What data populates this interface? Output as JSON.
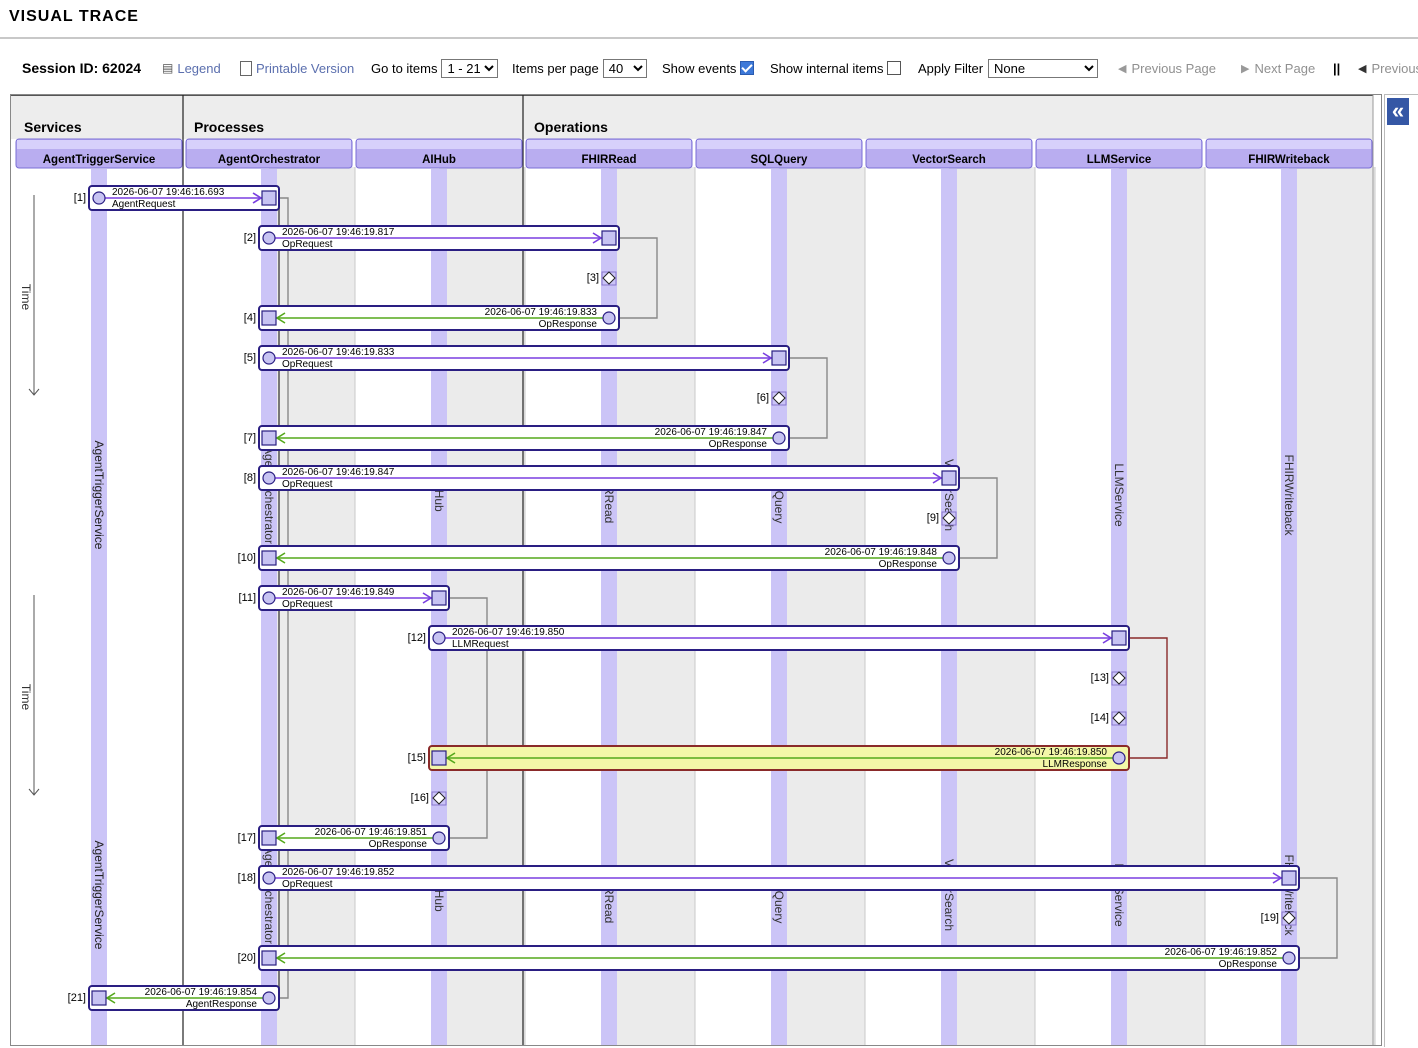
{
  "app_title": "VISUAL TRACE",
  "toolbar": {
    "session_label": "Session ID: 62024",
    "legend": "Legend",
    "printable": "Printable Version",
    "goto_label": "Go to items",
    "goto_value": "1 - 21",
    "per_page_label": "Items per page",
    "per_page_value": "40",
    "show_events_label": "Show events",
    "show_events_checked": true,
    "show_internal_label": "Show internal items",
    "show_internal_checked": false,
    "apply_filter_label": "Apply Filter",
    "filter_value": "None",
    "prev_page": "Previous Page",
    "next_page": "Next Page",
    "separator": "||",
    "previous": "Previous"
  },
  "groups": {
    "services": "Services",
    "processes": "Processes",
    "operations": "Operations"
  },
  "time_label": "Time",
  "columns": [
    {
      "name": "AgentTriggerService",
      "group": "services"
    },
    {
      "name": "AgentOrchestrator",
      "group": "processes"
    },
    {
      "name": "AIHub",
      "group": "processes"
    },
    {
      "name": "FHIRRead",
      "group": "operations"
    },
    {
      "name": "SQLQuery",
      "group": "operations"
    },
    {
      "name": "VectorSearch",
      "group": "operations"
    },
    {
      "name": "LLMService",
      "group": "operations"
    },
    {
      "name": "FHIRWriteback",
      "group": "operations"
    }
  ],
  "messages": [
    {
      "index": "[1]",
      "from": 0,
      "to": 1,
      "timestamp": "2026-06-07 19:46:16.693",
      "type": "AgentRequest",
      "kind": "request"
    },
    {
      "index": "[2]",
      "from": 1,
      "to": 3,
      "timestamp": "2026-06-07 19:46:19.817",
      "type": "OpRequest",
      "kind": "request"
    },
    {
      "index": "[3]",
      "col": 3,
      "kind": "event"
    },
    {
      "index": "[4]",
      "from": 3,
      "to": 1,
      "timestamp": "2026-06-07 19:46:19.833",
      "type": "OpResponse",
      "kind": "response"
    },
    {
      "index": "[5]",
      "from": 1,
      "to": 4,
      "timestamp": "2026-06-07 19:46:19.833",
      "type": "OpRequest",
      "kind": "request"
    },
    {
      "index": "[6]",
      "col": 4,
      "kind": "event"
    },
    {
      "index": "[7]",
      "from": 4,
      "to": 1,
      "timestamp": "2026-06-07 19:46:19.847",
      "type": "OpResponse",
      "kind": "response"
    },
    {
      "index": "[8]",
      "from": 1,
      "to": 5,
      "timestamp": "2026-06-07 19:46:19.847",
      "type": "OpRequest",
      "kind": "request"
    },
    {
      "index": "[9]",
      "col": 5,
      "kind": "event"
    },
    {
      "index": "[10]",
      "from": 5,
      "to": 1,
      "timestamp": "2026-06-07 19:46:19.848",
      "type": "OpResponse",
      "kind": "response"
    },
    {
      "index": "[11]",
      "from": 1,
      "to": 2,
      "timestamp": "2026-06-07 19:46:19.849",
      "type": "OpRequest",
      "kind": "request"
    },
    {
      "index": "[12]",
      "from": 2,
      "to": 6,
      "timestamp": "2026-06-07 19:46:19.850",
      "type": "LLMRequest",
      "kind": "request"
    },
    {
      "index": "[13]",
      "col": 6,
      "kind": "event"
    },
    {
      "index": "[14]",
      "col": 6,
      "kind": "event"
    },
    {
      "index": "[15]",
      "from": 6,
      "to": 2,
      "timestamp": "2026-06-07 19:46:19.850",
      "type": "LLMResponse",
      "kind": "response",
      "highlighted": true
    },
    {
      "index": "[16]",
      "col": 2,
      "kind": "event"
    },
    {
      "index": "[17]",
      "from": 2,
      "to": 1,
      "timestamp": "2026-06-07 19:46:19.851",
      "type": "OpResponse",
      "kind": "response"
    },
    {
      "index": "[18]",
      "from": 1,
      "to": 7,
      "timestamp": "2026-06-07 19:46:19.852",
      "type": "OpRequest",
      "kind": "request"
    },
    {
      "index": "[19]",
      "col": 7,
      "kind": "event"
    },
    {
      "index": "[20]",
      "from": 7,
      "to": 1,
      "timestamp": "2026-06-07 19:46:19.852",
      "type": "OpResponse",
      "kind": "response"
    },
    {
      "index": "[21]",
      "from": 1,
      "to": 0,
      "timestamp": "2026-06-07 19:46:19.854",
      "type": "AgentResponse",
      "kind": "response"
    }
  ],
  "colors": {
    "header_fill": "#b9adf0",
    "lane_stripe": "#cbc4f7",
    "box_border": "#2a1e82",
    "request_arrow": "#7a3fe0",
    "response_arrow": "#55a81c",
    "highlight_fill": "#f3f7a8",
    "highlight_border": "#8a2a2a",
    "toolbar_link": "#5b6fae"
  }
}
